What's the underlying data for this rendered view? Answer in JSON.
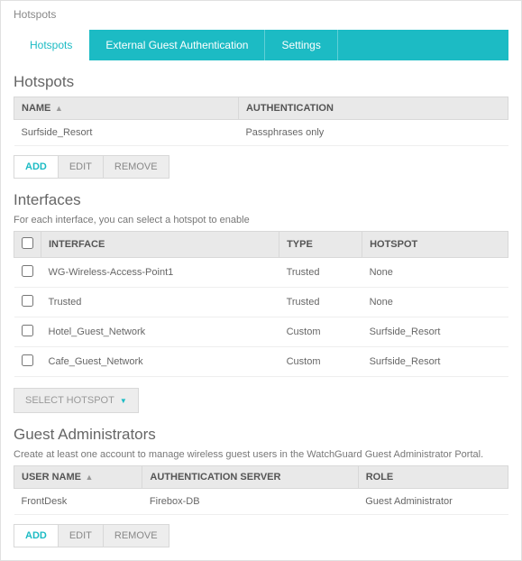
{
  "page_title": "Hotspots",
  "tabs": [
    {
      "label": "Hotspots",
      "active": true
    },
    {
      "label": "External Guest Authentication",
      "active": false
    },
    {
      "label": "Settings",
      "active": false
    }
  ],
  "hotspots": {
    "title": "Hotspots",
    "columns": {
      "name": "NAME",
      "auth": "AUTHENTICATION"
    },
    "rows": [
      {
        "name": "Surfside_Resort",
        "auth": "Passphrases only"
      }
    ],
    "buttons": {
      "add": "ADD",
      "edit": "EDIT",
      "remove": "REMOVE"
    }
  },
  "interfaces": {
    "title": "Interfaces",
    "subtitle": "For each interface, you can select a hotspot to enable",
    "columns": {
      "interface": "INTERFACE",
      "type": "TYPE",
      "hotspot": "HOTSPOT"
    },
    "rows": [
      {
        "interface": "WG-Wireless-Access-Point1",
        "type": "Trusted",
        "hotspot": "None"
      },
      {
        "interface": "Trusted",
        "type": "Trusted",
        "hotspot": "None"
      },
      {
        "interface": "Hotel_Guest_Network",
        "type": "Custom",
        "hotspot": "Surfside_Resort"
      },
      {
        "interface": "Cafe_Guest_Network",
        "type": "Custom",
        "hotspot": "Surfside_Resort"
      }
    ],
    "select_button": "SELECT HOTSPOT"
  },
  "guest_admins": {
    "title": "Guest Administrators",
    "subtitle": "Create at least one account to manage wireless guest users in the WatchGuard Guest Administrator Portal.",
    "columns": {
      "user": "USER NAME",
      "auth": "AUTHENTICATION SERVER",
      "role": "ROLE"
    },
    "rows": [
      {
        "user": "FrontDesk",
        "auth": "Firebox-DB",
        "role": "Guest Administrator"
      }
    ],
    "buttons": {
      "add": "ADD",
      "edit": "EDIT",
      "remove": "REMOVE"
    }
  }
}
